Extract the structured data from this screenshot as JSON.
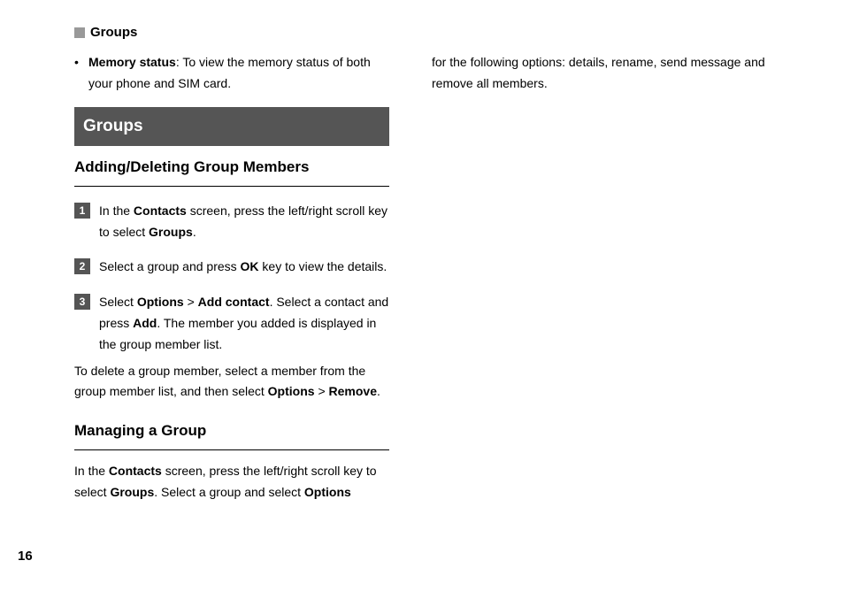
{
  "header": {
    "title": "Groups"
  },
  "col1": {
    "memory_status": {
      "label": "Memory status",
      "text": ": To view the memory status of both your phone and SIM card."
    },
    "section_title": "Groups",
    "subheading1": "Adding/Deleting Group Members",
    "step1": {
      "num": "1",
      "pre": "In the ",
      "b1": "Contacts",
      "mid": " screen, press the left/right scroll key to select ",
      "b2": "Groups",
      "post": "."
    },
    "step2": {
      "num": "2",
      "pre": "Select a group and press ",
      "b1": "OK",
      "post": " key to view the details."
    },
    "step3": {
      "num": "3",
      "pre": "Select ",
      "b1": "Options",
      "gt": " > ",
      "b2": "Add contact",
      "mid": ". Select a contact and press ",
      "b3": "Add",
      "post": ". The member you added is displayed in the group member list."
    },
    "delete_para": {
      "pre": "To delete a group member, select a member from the group member list, and then select ",
      "b1": "Options",
      "gt": " > ",
      "b2": "Remove",
      "post": "."
    },
    "subheading2": "Managing a Group",
    "manage_para": {
      "pre": "In the ",
      "b1": "Contacts",
      "mid": " screen, press the left/right scroll key to select ",
      "b2": "Groups",
      "mid2": ". Select a group and select ",
      "b3": "Options"
    }
  },
  "col2": {
    "cont": "for the following options: details, rename, send message and remove all members."
  },
  "page_number": "16"
}
